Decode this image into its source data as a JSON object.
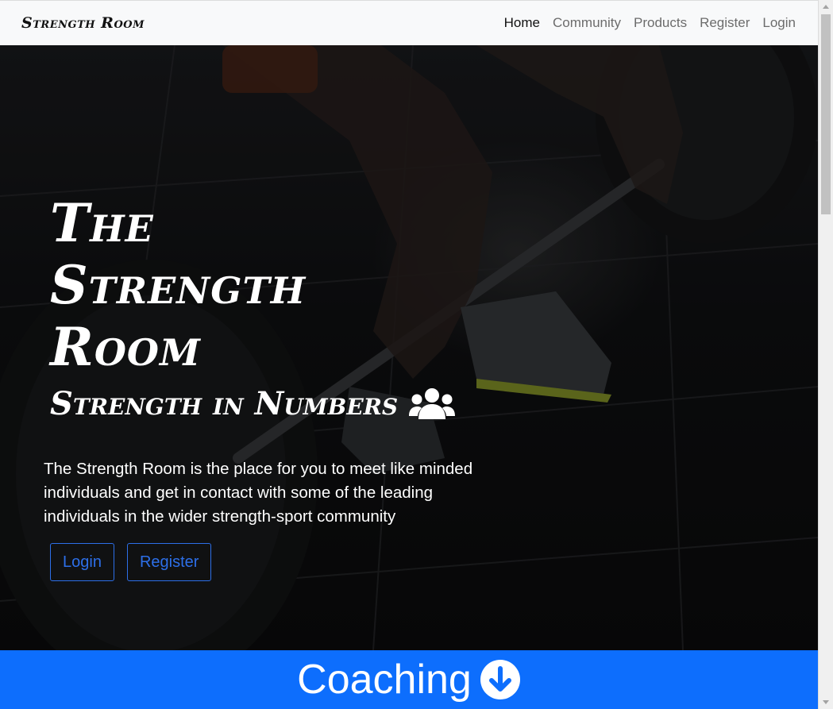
{
  "navbar": {
    "brand": "Strength Room",
    "links": [
      {
        "label": "Home",
        "active": true
      },
      {
        "label": "Community",
        "active": false
      },
      {
        "label": "Products",
        "active": false
      },
      {
        "label": "Register",
        "active": false
      },
      {
        "label": "Login",
        "active": false
      }
    ]
  },
  "hero": {
    "title": "The Strength Room",
    "subtitle": "Strength in Numbers",
    "subtitle_icon": "users-icon",
    "description": "The Strength Room is the place for you to meet like minded individuals and get in contact with some of the leading individuals in the wider strength-sport community",
    "buttons": {
      "login_label": "Login",
      "register_label": "Register"
    }
  },
  "coaching": {
    "label": "Coaching",
    "icon": "arrow-down-circle-icon"
  },
  "colors": {
    "primary": "#0d6efd",
    "button_outline": "#2d6fe8",
    "navbar_bg": "#f8f9fa"
  }
}
